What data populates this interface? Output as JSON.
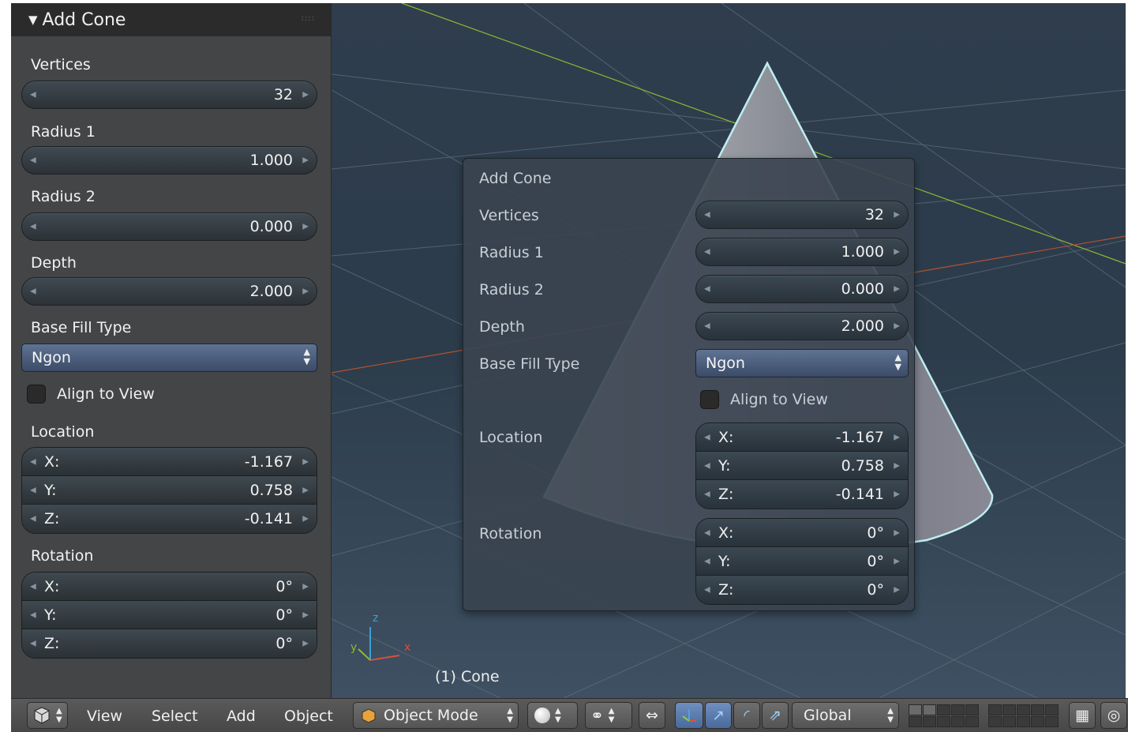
{
  "tool_panel": {
    "title": "Add Cone",
    "vertices_label": "Vertices",
    "vertices": "32",
    "radius1_label": "Radius 1",
    "radius1": "1.000",
    "radius2_label": "Radius 2",
    "radius2": "0.000",
    "depth_label": "Depth",
    "depth": "2.000",
    "fill_label": "Base Fill Type",
    "fill": "Ngon",
    "align_label": "Align to View",
    "location_label": "Location",
    "location": [
      {
        "axis": "X:",
        "value": "-1.167"
      },
      {
        "axis": "Y:",
        "value": "0.758"
      },
      {
        "axis": "Z:",
        "value": "-0.141"
      }
    ],
    "rotation_label": "Rotation",
    "rotation": [
      {
        "axis": "X:",
        "value": "0°"
      },
      {
        "axis": "Y:",
        "value": "0°"
      },
      {
        "axis": "Z:",
        "value": "0°"
      }
    ]
  },
  "popup": {
    "title": "Add Cone",
    "vertices_label": "Vertices",
    "vertices": "32",
    "radius1_label": "Radius 1",
    "radius1": "1.000",
    "radius2_label": "Radius 2",
    "radius2": "0.000",
    "depth_label": "Depth",
    "depth": "2.000",
    "fill_label": "Base Fill Type",
    "fill": "Ngon",
    "align_label": "Align to View",
    "location_label": "Location",
    "location": [
      {
        "axis": "X:",
        "value": "-1.167"
      },
      {
        "axis": "Y:",
        "value": "0.758"
      },
      {
        "axis": "Z:",
        "value": "-0.141"
      }
    ],
    "rotation_label": "Rotation",
    "rotation": [
      {
        "axis": "X:",
        "value": "0°"
      },
      {
        "axis": "Y:",
        "value": "0°"
      },
      {
        "axis": "Z:",
        "value": "0°"
      }
    ]
  },
  "viewport": {
    "object_label": "(1) Cone",
    "axis_x": "x",
    "axis_y": "y",
    "axis_z": "z"
  },
  "header": {
    "menu_view": "View",
    "menu_select": "Select",
    "menu_add": "Add",
    "menu_object": "Object",
    "mode": "Object Mode",
    "orientation": "Global"
  },
  "colors": {
    "viewport_bg": "#2e3d4c",
    "selection_outline": "#bfeef0",
    "x_axis": "#b5512e",
    "y_axis": "#8fb832"
  }
}
